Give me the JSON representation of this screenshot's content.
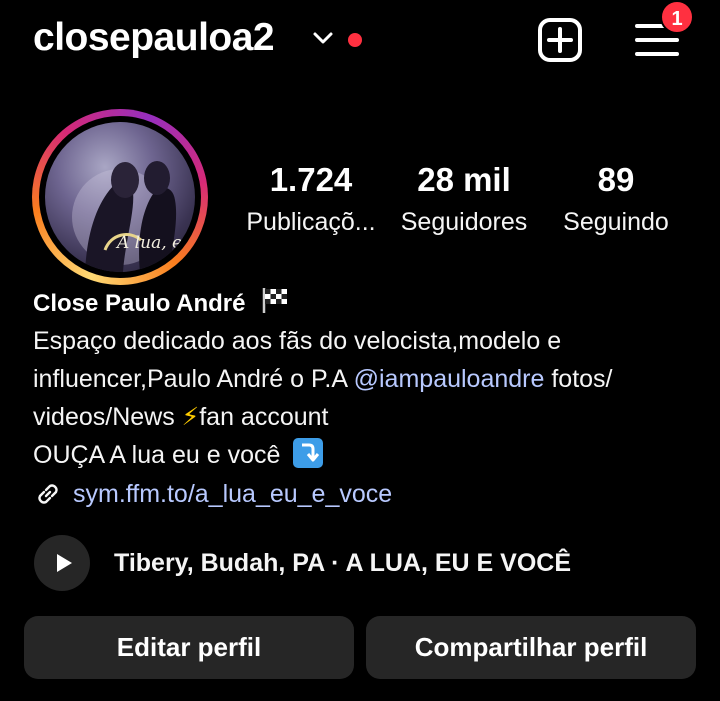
{
  "header": {
    "username": "closepauloa2",
    "notification_count": "1"
  },
  "stats": [
    {
      "value": "1.724",
      "label": "Publicaçõ..."
    },
    {
      "value": "28 mil",
      "label": "Seguidores"
    },
    {
      "value": "89",
      "label": "Seguindo"
    }
  ],
  "profile": {
    "display_name": "Close Paulo André",
    "name_emoji": "🏁",
    "bio": {
      "line1": "Espaço dedicado aos fãs do velocista,modelo e",
      "line2_before": "influencer,Paulo André o P.A ",
      "line2_mention": "@iampauloandre",
      "line2_after": "  fotos/",
      "line3_before": "videos/News ",
      "line3_emoji": "⚡",
      "line3_after": "fan account",
      "line4": "OUÇA A lua eu e você"
    },
    "link": "sym.ffm.to/a_lua_eu_e_voce",
    "avatar_text": "A lua, eu e você"
  },
  "music": {
    "text": "Tibery, Budah, PA · A LUA, EU E VOCÊ"
  },
  "actions": {
    "edit_profile": "Editar perfil",
    "share_profile": "Compartilhar perfil"
  },
  "colors": {
    "background": "#000000",
    "accent_red": "#ff3040",
    "link_blue": "#b8c9ff",
    "button_bg": "#262626"
  },
  "icons": [
    "chevron-down-icon",
    "new-post-icon",
    "menu-icon",
    "flag-icon",
    "lightning-icon",
    "down-arrow-icon",
    "link-icon",
    "play-icon"
  ]
}
